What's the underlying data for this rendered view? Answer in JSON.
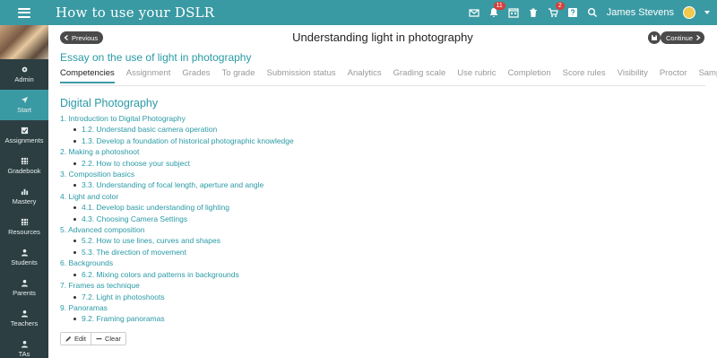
{
  "app": {
    "title": "How to use your DSLR"
  },
  "topbar": {
    "icons": [
      "mail-icon",
      "bell-icon",
      "calendar-icon",
      "trash-icon",
      "cart-icon",
      "help-icon",
      "search-icon"
    ],
    "notifications_count": "11",
    "cart_count": "2",
    "user_name": "James Stevens"
  },
  "sidebar": {
    "items": [
      {
        "label": "Admin",
        "icon": "gear-icon"
      },
      {
        "label": "Start",
        "icon": "arrow-icon",
        "active": true
      },
      {
        "label": "Assignments",
        "icon": "checkbox-icon"
      },
      {
        "label": "Gradebook",
        "icon": "grid-icon"
      },
      {
        "label": "Mastery",
        "icon": "bars-icon"
      },
      {
        "label": "Resources",
        "icon": "grid-icon"
      },
      {
        "label": "Students",
        "icon": "person-icon"
      },
      {
        "label": "Parents",
        "icon": "person-icon"
      },
      {
        "label": "Teachers",
        "icon": "person-icon"
      },
      {
        "label": "TAs",
        "icon": "person-icon"
      }
    ]
  },
  "header": {
    "previous_label": "Previous",
    "title": "Understanding light in photography",
    "continue_label": "Continue"
  },
  "assignment": {
    "title": "Essay on the use of light in photography"
  },
  "tabs": [
    "Competencies",
    "Assignment",
    "Grades",
    "To grade",
    "Submission status",
    "Analytics",
    "Grading scale",
    "Use rubric",
    "Completion",
    "Score rules",
    "Visibility",
    "Proctor",
    "Samples"
  ],
  "active_tab": "Competencies",
  "section": {
    "title": "Digital Photography"
  },
  "competencies": [
    {
      "label": "1. Introduction to Digital Photography",
      "subs": [
        "1.2. Understand basic camera operation",
        "1.3. Develop a foundation of historical photographic knowledge"
      ]
    },
    {
      "label": "2. Making a photoshoot",
      "subs": [
        "2.2. How to choose your subject"
      ]
    },
    {
      "label": "3. Composition basics",
      "subs": [
        "3.3. Understanding of focal length, aperture and angle"
      ]
    },
    {
      "label": "4. Light and color",
      "subs": [
        "4.1. Develop basic understanding of lighting",
        "4.3. Choosing Camera Settings"
      ]
    },
    {
      "label": "5. Advanced composition",
      "subs": [
        "5.2. How to use lines, curves and shapes",
        "5.3. The direction of movement"
      ]
    },
    {
      "label": "6. Backgrounds",
      "subs": [
        "6.2. Mixing colors and patterns in backgrounds"
      ]
    },
    {
      "label": "7. Frames as technique",
      "subs": [
        "7.2. Light in photoshoots"
      ]
    },
    {
      "label": "9. Panoramas",
      "subs": [
        "9.2. Framing panoramas"
      ]
    }
  ],
  "actions": {
    "edit_label": "Edit",
    "clear_label": "Clear"
  },
  "colors": {
    "accent": "#3a9aa3",
    "link": "#2a9aa6",
    "sidebar_bg": "#2c3e42",
    "badge": "#d43f3a"
  }
}
